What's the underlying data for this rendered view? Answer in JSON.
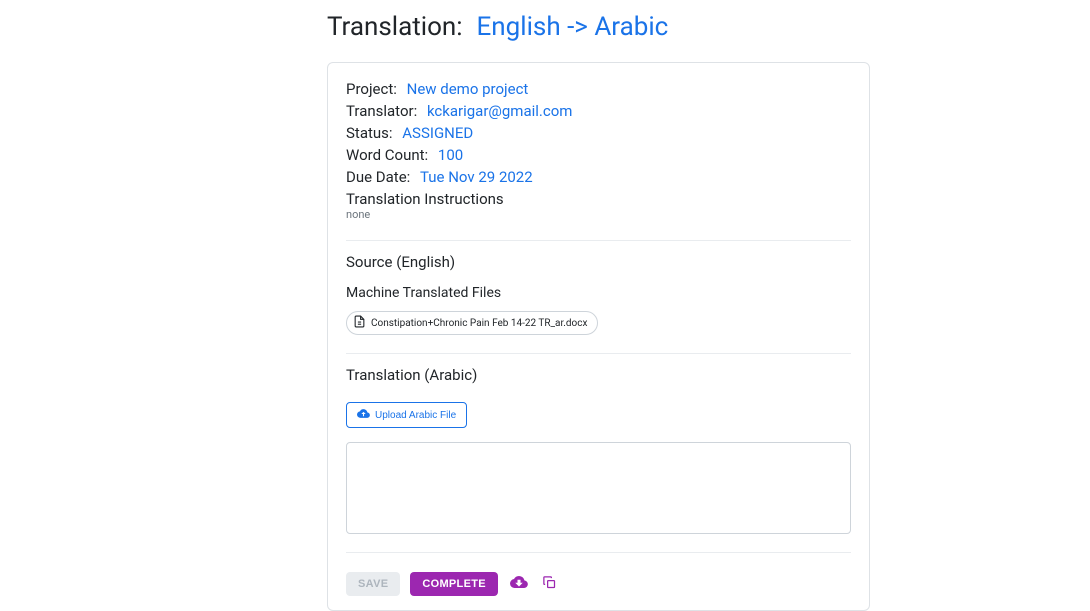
{
  "header": {
    "label": "Translation:",
    "value": "English -> Arabic"
  },
  "meta": {
    "project_label": "Project:",
    "project_value": "New demo project",
    "translator_label": "Translator:",
    "translator_value": "kckarigar@gmail.com",
    "status_label": "Status:",
    "status_value": "ASSIGNED",
    "wordcount_label": "Word Count:",
    "wordcount_value": "100",
    "due_label": "Due Date:",
    "due_value": "Tue Nov 29 2022",
    "instructions_label": "Translation Instructions",
    "instructions_value": "none"
  },
  "source": {
    "heading": "Source (English)",
    "mt_heading": "Machine Translated Files",
    "file_name": "Constipation+Chronic Pain Feb 14-22 TR_ar.docx"
  },
  "translation": {
    "heading": "Translation (Arabic)",
    "upload_label": "Upload Arabic File",
    "text_value": ""
  },
  "footer": {
    "save_label": "SAVE",
    "complete_label": "COMPLETE"
  }
}
